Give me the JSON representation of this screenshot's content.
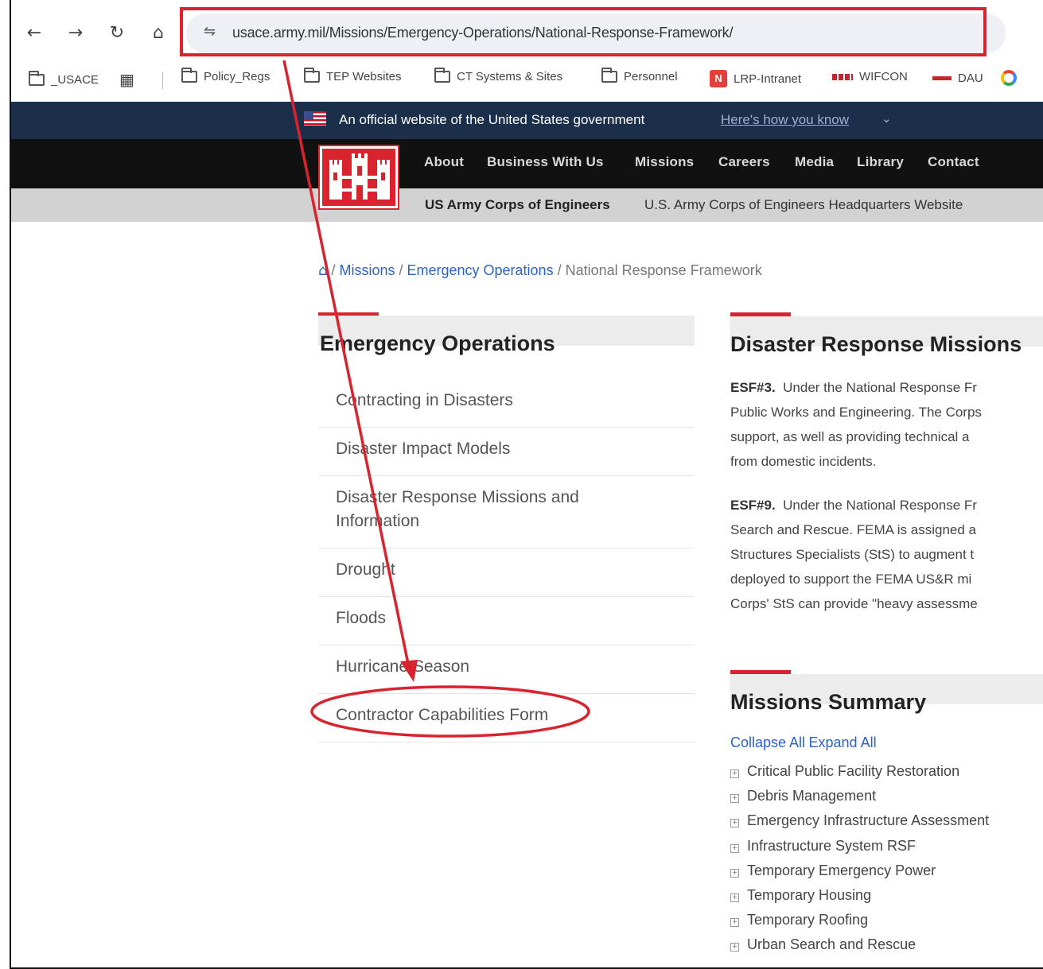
{
  "browser": {
    "url": "usace.army.mil/Missions/Emergency-Operations/National-Response-Framework/",
    "back_icon": "←",
    "forward_icon": "→",
    "reload_icon": "↻",
    "home_icon": "⌂",
    "site_info_icon": "⇋"
  },
  "bookmarks": [
    {
      "label": "_USACE"
    },
    {
      "label": "Policy_Regs"
    },
    {
      "label": "TEP Websites"
    },
    {
      "label": "CT Systems & Sites"
    },
    {
      "label": "Personnel"
    },
    {
      "label": "LRP-Intranet",
      "icon_text": "N"
    },
    {
      "label": "WIFCON"
    },
    {
      "label": "DAU"
    }
  ],
  "gov_banner": {
    "text": "An official website of the United States government",
    "link": "Here's how you know",
    "chevron": "⌄"
  },
  "site_nav": {
    "items": [
      "About",
      "Business With Us",
      "Missions",
      "Careers",
      "Media",
      "Library",
      "Contact"
    ]
  },
  "sub_header": {
    "org": "US Army Corps of Engineers",
    "site": "U.S. Army Corps of Engineers Headquarters Website"
  },
  "breadcrumb": {
    "home_icon": "⌂",
    "sep": " / ",
    "missions": "Missions",
    "emergency": "Emergency Operations",
    "current": "National Response Framework"
  },
  "left_section": {
    "title": "Emergency Operations",
    "items": [
      {
        "line1": "Contracting in Disasters"
      },
      {
        "line1": "Disaster Impact Models"
      },
      {
        "line1": "Disaster Response Missions and",
        "line2": "Information"
      },
      {
        "line1": "Drought"
      },
      {
        "line1": "Floods"
      },
      {
        "line1": "Hurricane Season"
      },
      {
        "line1": "Contractor Capabilities Form"
      }
    ]
  },
  "right_section": {
    "title": "Disaster Response Missions",
    "esf3": {
      "label": "ESF#3.",
      "lines": [
        "Under the National Response Fr",
        "Public Works and Engineering. The Corps",
        "support, as well as providing technical a",
        "from domestic incidents."
      ]
    },
    "esf9": {
      "label": "ESF#9.",
      "lines": [
        "Under the National Response Fr",
        "Search and Rescue.  FEMA is assigned a",
        "Structures Specialists (StS) to augment t",
        "deployed to support the FEMA US&R mi",
        "Corps' StS can provide \"heavy assessme"
      ]
    },
    "summary_title": "Missions Summary",
    "collapse": "Collapse All",
    "expand": "Expand All",
    "summary_items": [
      "Critical Public Facility Restoration",
      "Debris Management",
      "Emergency Infrastructure Assessment",
      "Infrastructure System RSF",
      "Temporary Emergency Power",
      "Temporary Housing",
      "Temporary Roofing",
      "Urban Search and Rescue"
    ]
  },
  "colors": {
    "accent_red": "#d9232e",
    "gov_banner": "#1c2f4a",
    "nav_bg": "#111111",
    "link_blue": "#2a63c9"
  }
}
